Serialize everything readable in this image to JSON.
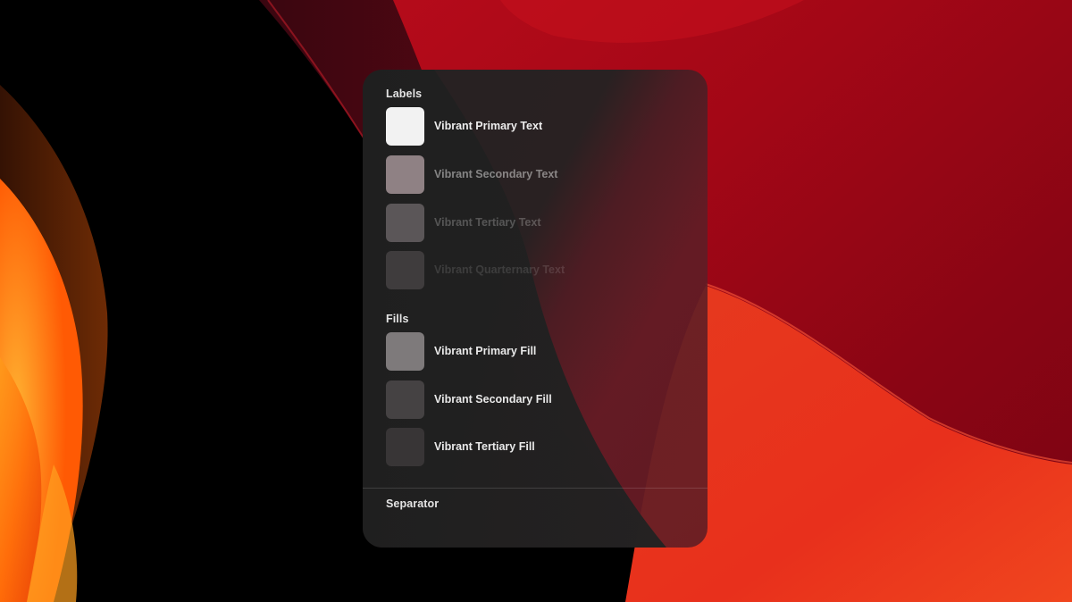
{
  "labels_section": {
    "title": "Labels",
    "items": [
      {
        "label": "Vibrant Primary Text",
        "swatch_color": "#f2f2f2",
        "text_color": "rgba(255,255,255,0.92)"
      },
      {
        "label": "Vibrant Secondary Text",
        "swatch_color": "#8f8184",
        "text_color": "rgba(255,255,255,0.45)"
      },
      {
        "label": "Vibrant Tertiary Text",
        "swatch_color": "#5b5658",
        "text_color": "rgba(255,255,255,0.24)"
      },
      {
        "label": "Vibrant Quarternary Text",
        "swatch_color": "#3f3c3d",
        "text_color": "rgba(255,255,255,0.13)"
      }
    ]
  },
  "fills_section": {
    "title": "Fills",
    "items": [
      {
        "label": "Vibrant Primary Fill",
        "swatch_color": "#7e7a7b",
        "text_color": "rgba(255,255,255,0.9)"
      },
      {
        "label": "Vibrant Secondary Fill",
        "swatch_color": "#454243",
        "text_color": "rgba(255,255,255,0.9)"
      },
      {
        "label": "Vibrant Tertiary Fill",
        "swatch_color": "#383536",
        "text_color": "rgba(255,255,255,0.9)"
      }
    ]
  },
  "separator_section": {
    "title": "Separator"
  },
  "colors": {
    "wallpaper_red": "#c8101c",
    "wallpaper_orange": "#ff7a0a",
    "panel_background": "#232323"
  }
}
